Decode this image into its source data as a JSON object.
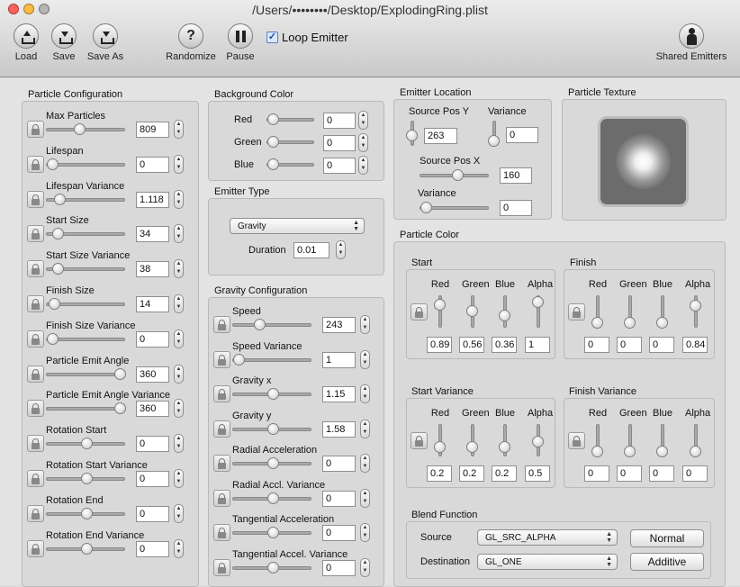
{
  "window": {
    "title": "/Users/••••••••/Desktop/ExplodingRing.plist"
  },
  "toolbar": {
    "load_label": "Load",
    "save_label": "Save",
    "save_as_label": "Save As",
    "randomize_label": "Randomize",
    "pause_label": "Pause",
    "loop_label": "Loop Emitter",
    "loop_checked": true,
    "shared_label": "Shared Emitters"
  },
  "particle_config": {
    "title": "Particle Configuration",
    "rows": [
      {
        "label": "Max Particles",
        "value": "809",
        "level": 0.4
      },
      {
        "label": "Lifespan",
        "value": "0",
        "level": 0.0
      },
      {
        "label": "Lifespan Variance",
        "value": "1.118",
        "level": 0.1
      },
      {
        "label": "Start Size",
        "value": "34",
        "level": 0.08
      },
      {
        "label": "Start Size Variance",
        "value": "38",
        "level": 0.08
      },
      {
        "label": "Finish Size",
        "value": "14",
        "level": 0.03
      },
      {
        "label": "Finish Size Variance",
        "value": "0",
        "level": 0.0
      },
      {
        "label": "Particle Emit Angle",
        "value": "360",
        "level": 1.0
      },
      {
        "label": "Particle Emit Angle Variance",
        "value": "360",
        "level": 1.0
      },
      {
        "label": "Rotation Start",
        "value": "0",
        "level": 0.5
      },
      {
        "label": "Rotation Start Variance",
        "value": "0",
        "level": 0.5
      },
      {
        "label": "Rotation End",
        "value": "0",
        "level": 0.5
      },
      {
        "label": "Rotation End Variance",
        "value": "0",
        "level": 0.5
      }
    ]
  },
  "background_color": {
    "title": "Background Color",
    "rows": [
      {
        "label": "Red",
        "value": "0",
        "level": 0.0
      },
      {
        "label": "Green",
        "value": "0",
        "level": 0.0
      },
      {
        "label": "Blue",
        "value": "0",
        "level": 0.0
      }
    ]
  },
  "emitter_type": {
    "title": "Emitter Type",
    "selected": "Gravity",
    "duration_label": "Duration",
    "duration_value": "0.01"
  },
  "gravity_config": {
    "title": "Gravity Configuration",
    "rows": [
      {
        "label": "Speed",
        "value": "243",
        "level": 0.3
      },
      {
        "label": "Speed Variance",
        "value": "1",
        "level": 0.0
      },
      {
        "label": "Gravity x",
        "value": "1.15",
        "level": 0.5
      },
      {
        "label": "Gravity y",
        "value": "1.58",
        "level": 0.5
      },
      {
        "label": "Radial Acceleration",
        "value": "0",
        "level": 0.5
      },
      {
        "label": "Radial Accl. Variance",
        "value": "0",
        "level": 0.5
      },
      {
        "label": "Tangential Acceleration",
        "value": "0",
        "level": 0.5
      },
      {
        "label": "Tangential Accel. Variance",
        "value": "0",
        "level": 0.5
      }
    ]
  },
  "emitter_location": {
    "title": "Emitter Location",
    "source_y_label": "Source Pos Y",
    "source_y_value": "263",
    "source_y_level": 0.4,
    "variance_y_label": "Variance",
    "variance_y_value": "0",
    "variance_y_level": 0.0,
    "source_x_label": "Source Pos X",
    "source_x_value": "160",
    "source_x_level": 0.55,
    "variance_x_label": "Variance",
    "variance_x_value": "0",
    "variance_x_level": 0.0
  },
  "particle_texture": {
    "title": "Particle Texture"
  },
  "particle_color": {
    "title": "Particle Color",
    "channel_labels": [
      "Red",
      "Green",
      "Blue",
      "Alpha"
    ],
    "start": {
      "title": "Start",
      "values": [
        "0.89",
        "0.56",
        "0.36",
        "1"
      ],
      "levels": [
        0.89,
        0.56,
        0.36,
        1.0
      ]
    },
    "finish": {
      "title": "Finish",
      "values": [
        "0",
        "0",
        "0",
        "0.84"
      ],
      "levels": [
        0,
        0,
        0,
        0.84
      ]
    },
    "start_variance": {
      "title": "Start Variance",
      "values": [
        "0.2",
        "0.2",
        "0.2",
        "0.5"
      ],
      "levels": [
        0.2,
        0.2,
        0.2,
        0.5
      ]
    },
    "finish_variance": {
      "title": "Finish Variance",
      "values": [
        "0",
        "0",
        "0",
        "0"
      ],
      "levels": [
        0,
        0,
        0,
        0
      ]
    }
  },
  "blend_function": {
    "title": "Blend Function",
    "source_label": "Source",
    "source_value": "GL_SRC_ALPHA",
    "destination_label": "Destination",
    "destination_value": "GL_ONE",
    "normal_label": "Normal",
    "additive_label": "Additive"
  }
}
